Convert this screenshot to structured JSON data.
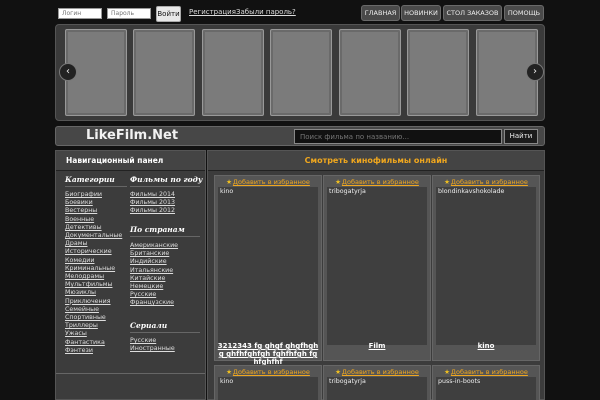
{
  "topbar": {
    "login_placeholder": "Логин",
    "password_placeholder": "Пароль",
    "login_button": "Войти",
    "register_link": "Регистрация",
    "forgot_link": "Забыли пароль?",
    "nav": [
      "ГЛАВНАЯ",
      "НОВИНКИ",
      "СТОЛ ЗАКАЗОВ",
      "ПОМОЩЬ"
    ]
  },
  "slider": {
    "prev": "‹",
    "next": "›"
  },
  "header": {
    "logo": "LikeFilm.Net",
    "search_placeholder": "Поиск фильма по названию...",
    "search_button": "Найти"
  },
  "sidebar": {
    "title": "Навигационный панел",
    "categories_heading": "Категории",
    "categories": [
      "Биографии",
      "Боевики",
      "Вестерны",
      "Военные",
      "Детективы",
      "Документальные",
      "Драмы",
      "Исторические",
      "Комедии",
      "Криминальные",
      "Мелодрамы",
      "Мультфильмы",
      "Мюзиклы",
      "Приключения",
      "Семейные",
      "Спортивные",
      "Триллеры",
      "Ужасы",
      "Фантастика",
      "Фэнтези"
    ],
    "years_heading": "Фильмы по году",
    "years": [
      "Фильмы 2014",
      "Фильмы 2013",
      "Фильмы 2012"
    ],
    "countries_heading": "По странам",
    "countries": [
      "Американские",
      "Британские",
      "Индийские",
      "Итальянские",
      "Китайские",
      "Немецкие",
      "Русские",
      "Французские"
    ],
    "series_heading": "Сериали",
    "series": [
      "Русские",
      "Иностранные"
    ]
  },
  "content": {
    "title": "Смотреть кинофильмы онлайн",
    "fav_label": "Добавить в избранное",
    "cards": [
      {
        "name": "kino",
        "title": "3212343 fg ghgf ghgfhghg ghfhfghfgh fghfhfgh fghfghfhf"
      },
      {
        "name": "tribogatyrja",
        "title": "Film"
      },
      {
        "name": "blondinkavshokolade",
        "title": "kino"
      },
      {
        "name": "kino",
        "title": ""
      },
      {
        "name": "tribogatyrja",
        "title": ""
      },
      {
        "name": "puss-in-boots",
        "title": ""
      }
    ]
  }
}
